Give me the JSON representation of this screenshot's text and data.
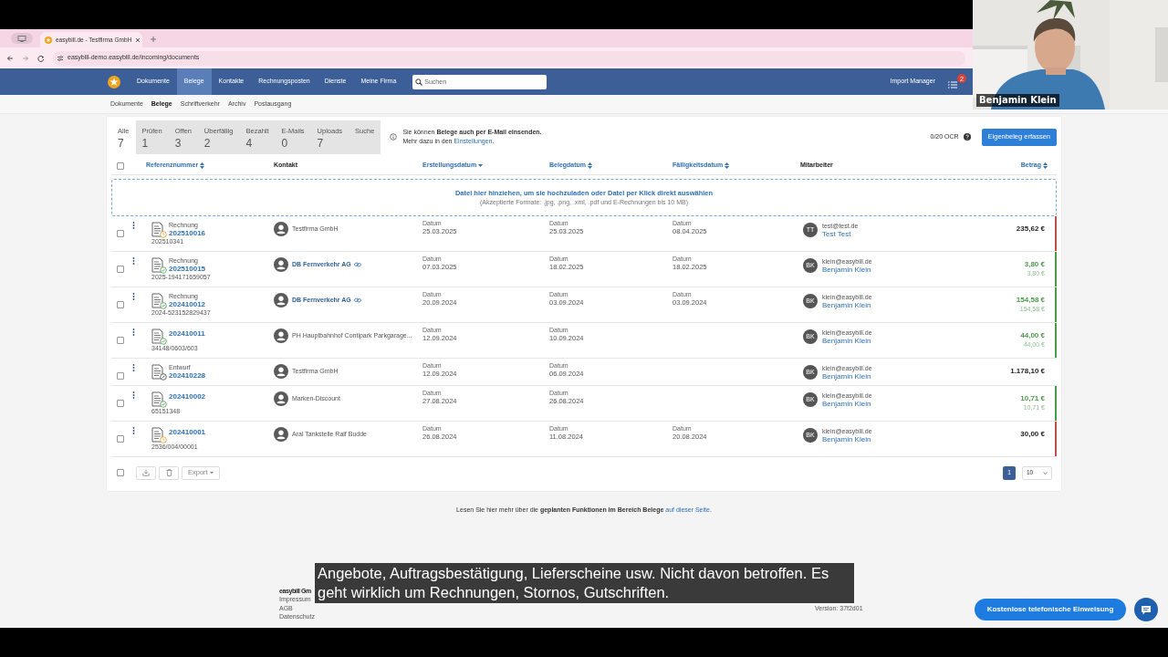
{
  "browser": {
    "tab_title": "easybill.de - Testfirma GmbH",
    "url": "easybill-demo.easybill.de/incoming/documents"
  },
  "nav": {
    "items": [
      {
        "label": "Dokumente",
        "selected": false
      },
      {
        "label": "Belege",
        "selected": true
      },
      {
        "label": "Kontakte",
        "selected": false
      },
      {
        "label": "Rechnungsposten",
        "selected": false
      },
      {
        "label": "Dienste",
        "selected": false
      },
      {
        "label": "Meine Firma",
        "selected": false
      }
    ],
    "search": {
      "placeholder": "Suchen"
    },
    "import_manager": "Import Manager",
    "badge": "2"
  },
  "subnav": [
    {
      "label": "Dokumente",
      "selected": false
    },
    {
      "label": "Belege",
      "selected": true
    },
    {
      "label": "Schriftverkehr",
      "selected": false
    },
    {
      "label": "Archiv",
      "selected": false
    },
    {
      "label": "Postausgang",
      "selected": false
    }
  ],
  "filter_tabs": [
    {
      "label": "Alle",
      "count": "7",
      "selected": true
    },
    {
      "label": "Prüfen",
      "count": "1",
      "selected": false
    },
    {
      "label": "Offen",
      "count": "3",
      "selected": false
    },
    {
      "label": "Überfällig",
      "count": "2",
      "selected": false
    },
    {
      "label": "Bezahlt",
      "count": "4",
      "selected": false
    },
    {
      "label": "E-Mails",
      "count": "0",
      "selected": false
    },
    {
      "label": "Uploads",
      "count": "7",
      "selected": false
    },
    {
      "label": "Suche",
      "selected": false
    }
  ],
  "info": {
    "text": "Sie können **Belege auch per E-Mail einsenden.** Mehr dazu in den",
    "link": "Einstellungen",
    "suffix": "."
  },
  "ocr": "0/20 OCR",
  "primary_button": "Eigenbeleg erfassen",
  "select_all": {
    "checked": false
  },
  "columns": [
    {
      "label": "Referenznummer",
      "kind": "sortable"
    },
    {
      "label": "Kontakt",
      "kind": "plain"
    },
    {
      "label": "Erstellungsdatum",
      "kind": "sorted"
    },
    {
      "label": "Belegdatum",
      "kind": "sortable"
    },
    {
      "label": "Fälligkeitsdatum",
      "kind": "sortable"
    },
    {
      "label": "Mitarbeiter",
      "kind": "plain"
    },
    {
      "label": "Betrag",
      "kind": "sortable"
    }
  ],
  "dropzone": {
    "title": "Datei hier hinziehen, um sie hochzuladen oder Datei per Klick direkt auswählen",
    "hint": "(Akzeptierte Formate: .jpg, .png, .xml, .pdf und E-Rechnungen bis 10 MB)"
  },
  "rows": [
    {
      "checked": false,
      "kind": "open",
      "type": "Rechnung",
      "number": "202510016",
      "reference": "202510341",
      "contact": "Testfirma GmbH",
      "contact_linked": false,
      "created": {
        "label": "Datum",
        "value": "25.03.2025"
      },
      "document_date": {
        "label": "Datum",
        "value": "25.03.2025"
      },
      "due": {
        "label": "Datum",
        "value": "08.04.2025"
      },
      "initials": "TT",
      "email": "test@test.de",
      "employee": "Test Test",
      "amount": "235,62 €",
      "paid": false,
      "color": "#c0504d"
    },
    {
      "checked": false,
      "kind": "paid",
      "type": "Rechnung",
      "number": "202510015",
      "reference": "2025-194171659057",
      "contact": "DB Fernverkehr AG",
      "contact_linked": true,
      "created": {
        "label": "Datum",
        "value": "07.03.2025"
      },
      "document_date": {
        "label": "Datum",
        "value": "18.02.2025"
      },
      "due": {
        "label": "Datum",
        "value": "18.02.2025"
      },
      "initials": "BK",
      "email": "klein@easybill.de",
      "employee": "Benjamin Klein",
      "amount": "3,80 €",
      "paid_amount": "3,80 €",
      "paid": true,
      "color": "#4a9a4a"
    },
    {
      "checked": false,
      "kind": "paid",
      "type": "Rechnung",
      "number": "202410012",
      "reference": "2024-523152829437",
      "contact": "DB Fernverkehr AG",
      "contact_linked": true,
      "created": {
        "label": "Datum",
        "value": "20.09.2024"
      },
      "document_date": {
        "label": "Datum",
        "value": "03.09.2024"
      },
      "due": {
        "label": "Datum",
        "value": "03.09.2024"
      },
      "initials": "BK",
      "email": "klein@easybill.de",
      "employee": "Benjamin Klein",
      "amount": "154,58 €",
      "paid_amount": "154,58 €",
      "paid": true,
      "color": "#4a9a4a"
    },
    {
      "checked": false,
      "kind": "paid",
      "number": "202410011",
      "reference": "34148/0603/603",
      "contact": "PH Hauptbahnhof Contipark Parkgarage...",
      "contact_linked": false,
      "created": {
        "label": "Datum",
        "value": "12.09.2024"
      },
      "document_date": {
        "label": "Datum",
        "value": "10.09.2024"
      },
      "initials": "BK",
      "email": "klein@easybill.de",
      "employee": "Benjamin Klein",
      "amount": "44,00 €",
      "paid_amount": "44,00 €",
      "paid": true,
      "color": "#4a9a4a"
    },
    {
      "checked": false,
      "kind": "draft",
      "type": "Entwurf",
      "number": "202410228",
      "contact": "Testfirma GmbH",
      "contact_linked": false,
      "created": {
        "label": "Datum",
        "value": "12.09.2024"
      },
      "document_date": {
        "label": "Datum",
        "value": "06.09.2024"
      },
      "initials": "BK",
      "email": "klein@easybill.de",
      "employee": "Benjamin Klein",
      "amount": "1.178,10 €",
      "paid": false
    },
    {
      "checked": false,
      "kind": "paid",
      "number": "202410002",
      "reference": "65151348",
      "contact": "Marken-Discount",
      "contact_linked": false,
      "created": {
        "label": "Datum",
        "value": "27.08.2024"
      },
      "document_date": {
        "label": "Datum",
        "value": "26.08.2024"
      },
      "initials": "BK",
      "email": "klein@easybill.de",
      "employee": "Benjamin Klein",
      "amount": "10,71 €",
      "paid_amount": "10,71 €",
      "paid": true,
      "color": "#4a9a4a"
    },
    {
      "checked": false,
      "kind": "open",
      "number": "202410001",
      "reference": "2536/004/00001",
      "contact": "Aral Tankstelle Ralf Budde",
      "contact_linked": false,
      "created": {
        "label": "Datum",
        "value": "26.08.2024"
      },
      "document_date": {
        "label": "Datum",
        "value": "11.08.2024"
      },
      "due": {
        "label": "Datum",
        "value": "20.08.2024"
      },
      "initials": "BK",
      "email": "klein@easybill.de",
      "employee": "Benjamin Klein",
      "amount": "30,00 €",
      "paid": false,
      "color": "#c0504d"
    }
  ],
  "bulk": {
    "checked": false,
    "export": "Export"
  },
  "pagination": {
    "pages": [
      {
        "label": "1",
        "selected": true
      }
    ],
    "page_size": "10"
  },
  "footer_note": {
    "text": "Lesen Sie hier mehr über die **geplanten Funktionen im Bereich Belege**",
    "link": "auf dieser Seite",
    "suffix": "."
  },
  "page_footer": {
    "left": [
      "easybill Gm",
      "Impressum",
      "AGB",
      "Datenschutz"
    ],
    "right": [
      "Version: 37f2d01"
    ]
  },
  "subtitle": "Angebote, Auftragsbestätigung, Lieferscheine usw. Nicht davon betroffen. Es geht wirklich um Rechnungen, Stornos, Gutschriften.",
  "help_button": "Kostenlose telefonische Einweisung",
  "webcam": {
    "name": "Benjamin Klein"
  }
}
